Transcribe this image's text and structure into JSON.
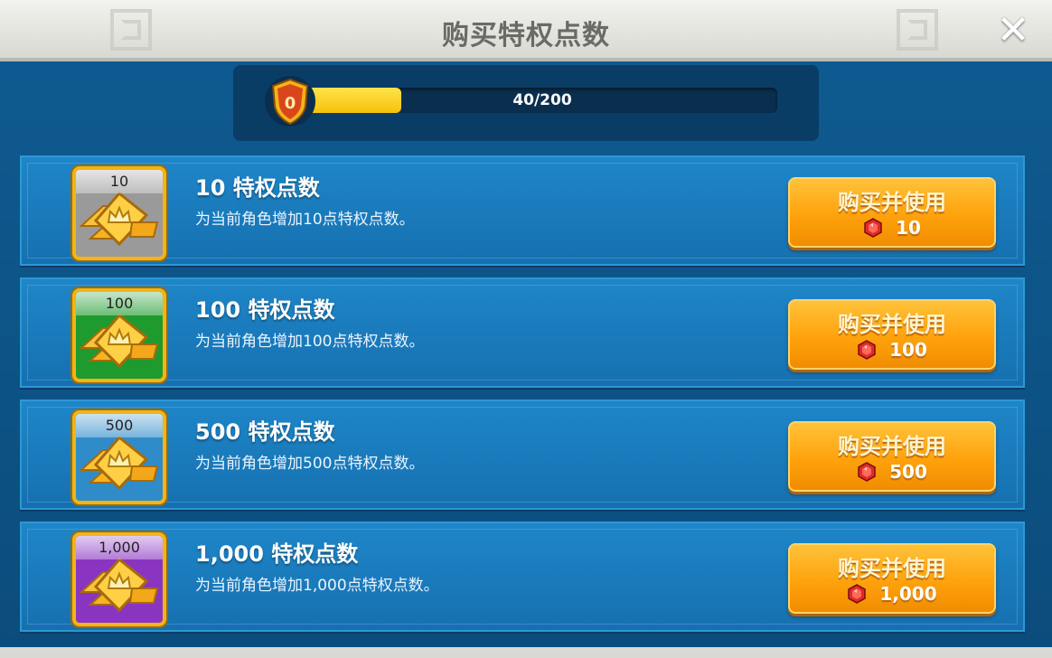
{
  "title": "购买特权点数",
  "progress": {
    "level": "0",
    "text": "40/200",
    "fraction": 0.2
  },
  "colors": {
    "button": "#ffa20c",
    "bar_fill": "#f5c10a",
    "row_bg": "#1e86c8"
  },
  "items": [
    {
      "tile_label": "10",
      "title": "10 特权点数",
      "desc": "为当前角色增加10点特权点数。",
      "buy_label": "购买并使用",
      "price": "10",
      "tile_color": "#9a9a9a"
    },
    {
      "tile_label": "100",
      "title": "100 特权点数",
      "desc": "为当前角色增加100点特权点数。",
      "buy_label": "购买并使用",
      "price": "100",
      "tile_color": "#1e9a2e"
    },
    {
      "tile_label": "500",
      "title": "500 特权点数",
      "desc": "为当前角色增加500点特权点数。",
      "buy_label": "购买并使用",
      "price": "500",
      "tile_color": "#2f8cc8"
    },
    {
      "tile_label": "1,000",
      "title": "1,000 特权点数",
      "desc": "为当前角色增加1,000点特权点数。",
      "buy_label": "购买并使用",
      "price": "1,000",
      "tile_color": "#8a34c2"
    }
  ]
}
